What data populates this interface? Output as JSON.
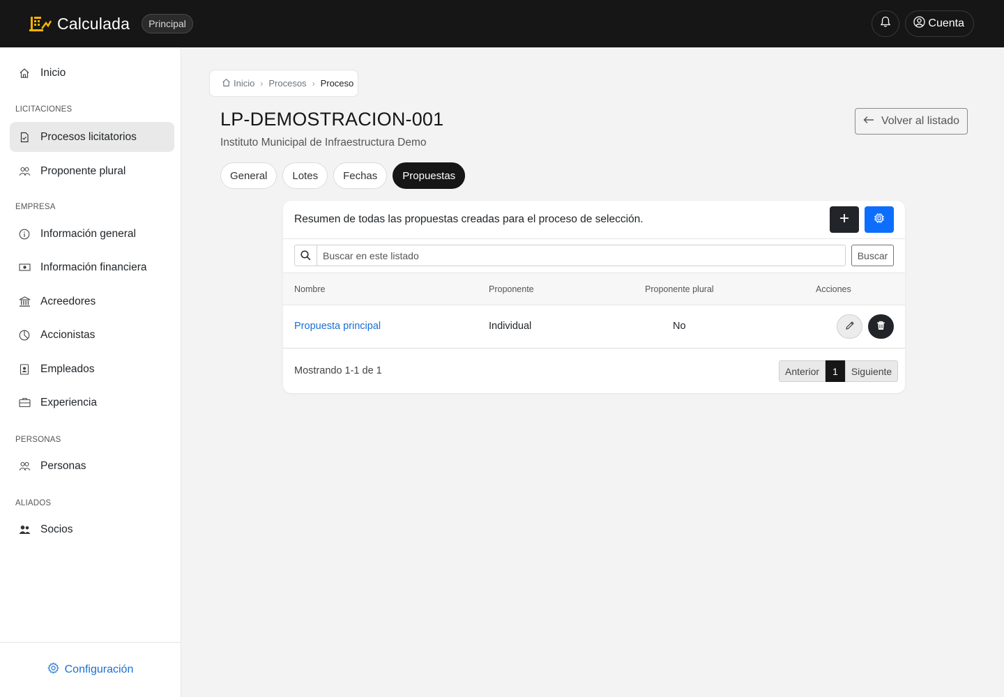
{
  "topbar": {
    "brand": "Calculada",
    "env_badge": "Principal",
    "account_label": "Cuenta"
  },
  "sidebar": {
    "home": "Inicio",
    "sections": {
      "licitaciones": "LICITACIONES",
      "empresa": "EMPRESA",
      "personas": "PERSONAS",
      "aliados": "ALIADOS"
    },
    "items": {
      "procesos": "Procesos licitatorios",
      "proponente_plural": "Proponente plural",
      "info_general": "Información general",
      "info_financiera": "Información financiera",
      "acreedores": "Acreedores",
      "accionistas": "Accionistas",
      "empleados": "Empleados",
      "experiencia": "Experiencia",
      "personas": "Personas",
      "socios": "Socios"
    },
    "footer": "Configuración"
  },
  "breadcrumb": [
    "Inicio",
    "Procesos",
    "Proceso"
  ],
  "page": {
    "title": "LP-DEMOSTRACION-001",
    "subtitle": "Instituto Municipal de Infraestructura Demo",
    "back_label": "Volver al listado"
  },
  "tabs": [
    "General",
    "Lotes",
    "Fechas",
    "Propuestas"
  ],
  "active_tab": "Propuestas",
  "card": {
    "description": "Resumen de todas las propuestas creadas para el proceso de selección.",
    "search_placeholder": "Buscar en este listado",
    "search_button": "Buscar",
    "columns": [
      "Nombre",
      "Proponente",
      "Proponente plural",
      "Acciones"
    ],
    "rows": [
      {
        "nombre": "Propuesta principal",
        "proponente": "Individual",
        "plural": "No"
      }
    ],
    "showing": "Mostrando 1-1 de 1",
    "pager": {
      "prev": "Anterior",
      "current": "1",
      "next": "Siguiente"
    }
  },
  "colors": {
    "topbar": "#161616",
    "accent_blue": "#0d6efd",
    "link": "#1a6fd4",
    "logo_yellow": "#f5b400"
  },
  "icons": [
    "logo-icon",
    "bell-icon",
    "user-circle-icon",
    "home-icon",
    "file-check-icon",
    "people-icon",
    "info-icon",
    "cash-icon",
    "bank-icon",
    "pie-chart-icon",
    "badge-icon",
    "briefcase-icon",
    "people-fill-icon",
    "gear-icon",
    "arrow-left-icon",
    "plus-icon",
    "cpu-icon",
    "search-icon",
    "pencil-icon",
    "trash-icon",
    "chevron-right-icon"
  ]
}
